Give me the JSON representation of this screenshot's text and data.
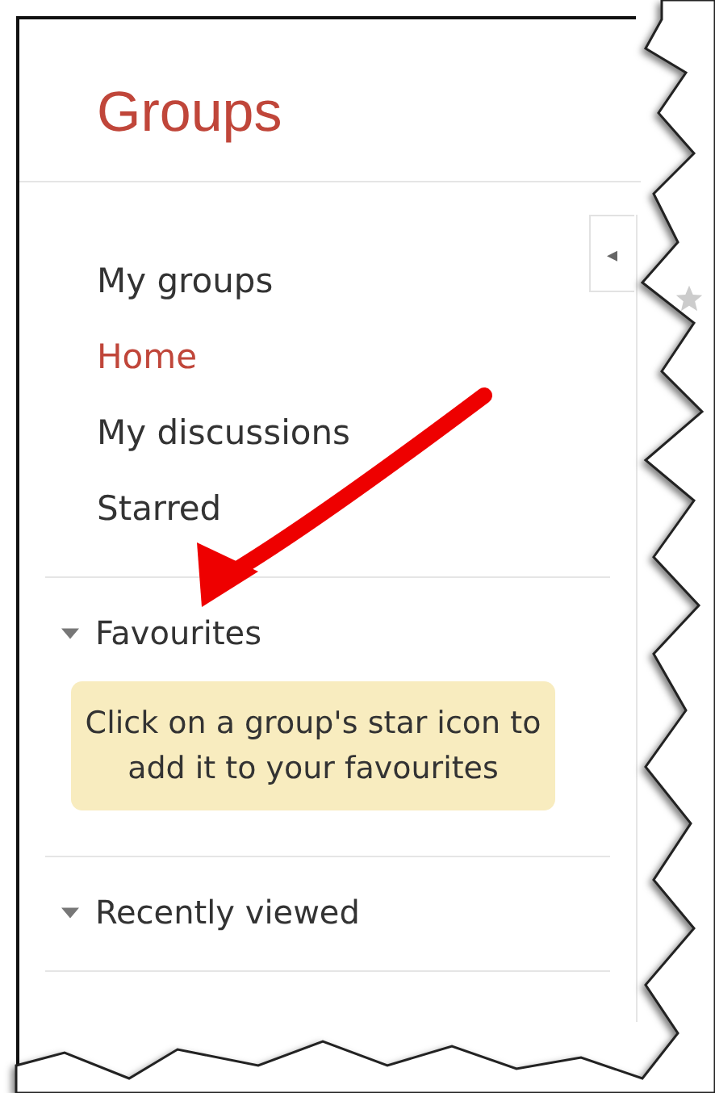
{
  "title": "Groups",
  "collapse_button": {
    "label": "◂"
  },
  "nav": [
    {
      "label": "My groups",
      "selected": false
    },
    {
      "label": "Home",
      "selected": true
    },
    {
      "label": "My discussions",
      "selected": false
    },
    {
      "label": "Starred",
      "selected": false
    }
  ],
  "sections": [
    {
      "label": "Favourites",
      "expanded": true,
      "hint": "Click on a group's star icon to add it to your favourites"
    },
    {
      "label": "Recently viewed",
      "expanded": true
    }
  ]
}
